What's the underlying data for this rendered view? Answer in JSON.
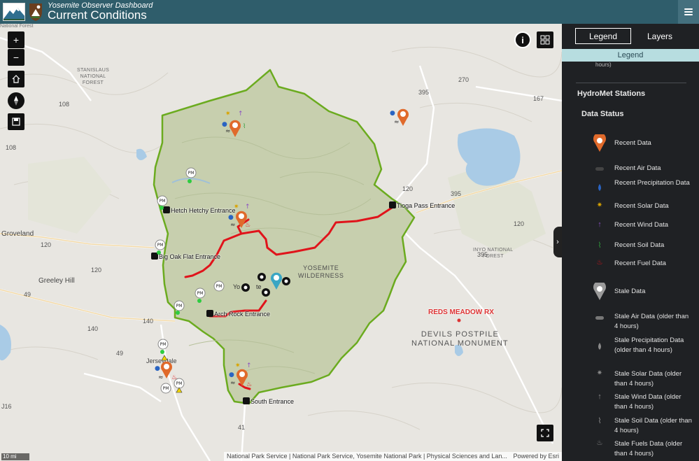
{
  "header": {
    "subtitle": "Yosemite Observer Dashboard",
    "title": "Current Conditions"
  },
  "map": {
    "place_labels": [
      "Groveland",
      "Greeley Hill",
      "Jerseydale",
      "Yo",
      "te",
      "National Forest"
    ],
    "forest_labels": [
      "STANISLAUS\nNATIONAL\nFOREST",
      "INYO NATIONAL\nFOREST"
    ],
    "road_shields": [
      "108",
      "108",
      "120",
      "120",
      "120",
      "120",
      "49",
      "49",
      "140",
      "140",
      "41",
      "395",
      "395",
      "395",
      "270",
      "167",
      "J16"
    ],
    "wilderness_label": "YOSEMITE\nWILDERNESS",
    "monument_label": "DEVILS POSTPILE\nNATIONAL MONUMENT",
    "fire_label": "REDS MEADOW RX",
    "entrances": [
      "Hetch Hetchy Entrance",
      "Tioga Pass Entrance",
      "Big Oak Flat Entrance",
      "Arch Rock Entrance",
      "South Entrance"
    ],
    "pm_label": "PM",
    "scale": "10 mi",
    "attribution": "National Park Service | National Park Service, Yosemite National Park | Physical Sciences and Lan...",
    "powered_by": "Powered by Esri",
    "colors": {
      "park_fill": "#c6cfae",
      "park_border": "#6bab1f",
      "road_red": "#e0141b",
      "recent_marker": "#e06a2b",
      "stale_marker": "#9a9a9a",
      "lake": "#a9cbe6"
    }
  },
  "panel": {
    "tabs": [
      "Legend",
      "Layers"
    ],
    "legend_bar": "Legend",
    "clipped_text": "hours)",
    "section_title": "HydroMet Stations",
    "status_title": "Data Status",
    "items": [
      {
        "label": "Recent Data",
        "icon": "recent-data-marker"
      },
      {
        "label": "Recent Air Data",
        "icon": "air-icon"
      },
      {
        "label": "Recent Precipitation Data",
        "icon": "raindrop-icon"
      },
      {
        "label": "Recent Solar Data",
        "icon": "sun-icon"
      },
      {
        "label": "Recent Wind Data",
        "icon": "wind-icon"
      },
      {
        "label": "Recent Soil Data",
        "icon": "soil-icon"
      },
      {
        "label": "Recent Fuel Data",
        "icon": "fuel-icon"
      },
      {
        "label": "Stale Data",
        "icon": "stale-data-marker"
      },
      {
        "label": "Stale Air Data (older than 4 hours)",
        "icon": "air-icon"
      },
      {
        "label": "Stale Precipitation Data (older than 4 hours)",
        "icon": "raindrop-icon"
      },
      {
        "label": "Stale Solar Data (older than 4 hours)",
        "icon": "sun-icon"
      },
      {
        "label": "Stale Wind Data (older than 4 hours)",
        "icon": "wind-icon"
      },
      {
        "label": "Stale Soil Data (older than 4 hours)",
        "icon": "soil-icon"
      },
      {
        "label": "Stale Fuels Data (older than 4 hours)",
        "icon": "fuel-icon"
      }
    ]
  }
}
